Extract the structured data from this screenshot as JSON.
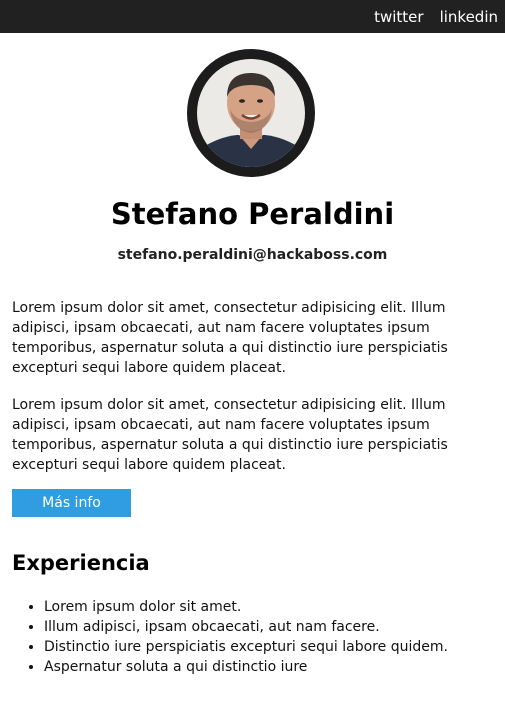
{
  "nav": {
    "twitter": "twitter",
    "linkedin": "linkedin"
  },
  "profile": {
    "name": "Stefano Peraldini",
    "email": "stefano.peraldini@hackaboss.com"
  },
  "about": {
    "paragraphs": [
      "Lorem ipsum dolor sit amet, consectetur adipisicing elit. Illum adipisci, ipsam obcaecati, aut nam facere voluptates ipsum temporibus, aspernatur soluta a qui distinctio iure perspiciatis excepturi sequi labore quidem placeat.",
      "Lorem ipsum dolor sit amet, consectetur adipisicing elit. Illum adipisci, ipsam obcaecati, aut nam facere voluptates ipsum temporibus, aspernatur soluta a qui distinctio iure perspiciatis excepturi sequi labore quidem placeat."
    ],
    "more_button": "Más info"
  },
  "experience": {
    "title": "Experiencia",
    "items": [
      "Lorem ipsum dolor sit amet.",
      "Illum adipisci, ipsam obcaecati, aut nam facere.",
      "Distinctio iure perspiciatis excepturi sequi labore quidem.",
      "Aspernatur soluta a qui distinctio iure"
    ]
  },
  "colors": {
    "topbar": "#212121",
    "button": "#2f9ddf",
    "avatar_ring": "#1c1c1c"
  }
}
